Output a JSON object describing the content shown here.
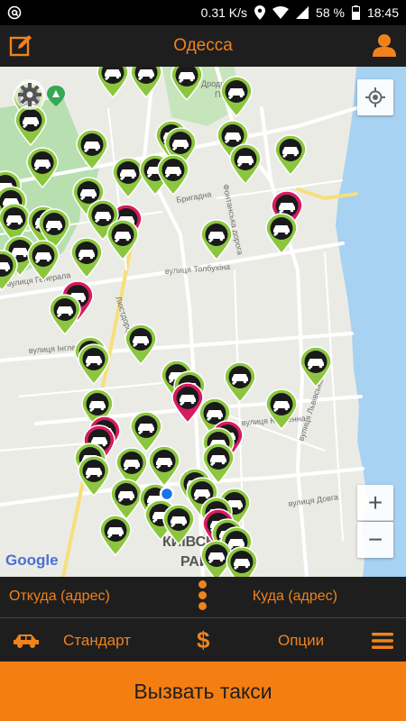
{
  "statusbar": {
    "left_icon": "at-icon",
    "network_speed": "0.31 K/s",
    "battery_percent": "58 %",
    "time": "18:45"
  },
  "header": {
    "title": "Одесса"
  },
  "map": {
    "labels": [
      "Дродромк",
      "Перем",
      "вулиця Толбухіна",
      "Бригадна",
      "Фонтанська дорога",
      "Люстдорфська",
      "вулиця Генерала",
      "вулиця Інглезі",
      "вулиця Косвенна",
      "вулиця Львівська",
      "вулиця Довга",
      "КИЇВСЬКИЙ",
      "РАЙОН",
      "Google"
    ],
    "zoom_in_label": "+",
    "zoom_out_label": "−",
    "colors": {
      "taxi_free": "#8cc63f",
      "taxi_busy": "#d81b60",
      "water": "#a7d2f1",
      "park": "#b8dfb0"
    },
    "taxi_markers": [
      [
        125,
        82,
        "g"
      ],
      [
        162,
        82,
        "g"
      ],
      [
        207,
        85,
        "g"
      ],
      [
        262,
        103,
        "g"
      ],
      [
        32,
        110,
        "g"
      ],
      [
        34,
        135,
        "g"
      ],
      [
        190,
        152,
        "g"
      ],
      [
        200,
        160,
        "g"
      ],
      [
        258,
        152,
        "g"
      ],
      [
        102,
        162,
        "g"
      ],
      [
        322,
        168,
        "g"
      ],
      [
        272,
        178,
        "g"
      ],
      [
        47,
        182,
        "g"
      ],
      [
        142,
        193,
        "g"
      ],
      [
        172,
        190,
        "g"
      ],
      [
        192,
        190,
        "g"
      ],
      [
        6,
        208,
        "g"
      ],
      [
        98,
        215,
        "g"
      ],
      [
        12,
        225,
        "g"
      ],
      [
        318,
        230,
        "p"
      ],
      [
        140,
        245,
        "p"
      ],
      [
        114,
        240,
        "g"
      ],
      [
        16,
        244,
        "g"
      ],
      [
        48,
        247,
        "g"
      ],
      [
        60,
        250,
        "g"
      ],
      [
        136,
        262,
        "g"
      ],
      [
        312,
        255,
        "g"
      ],
      [
        240,
        262,
        "g"
      ],
      [
        22,
        280,
        "g"
      ],
      [
        48,
        285,
        "g"
      ],
      [
        96,
        282,
        "g"
      ],
      [
        2,
        296,
        "g"
      ],
      [
        86,
        330,
        "p"
      ],
      [
        72,
        345,
        "g"
      ],
      [
        156,
        378,
        "g"
      ],
      [
        100,
        392,
        "g"
      ],
      [
        104,
        400,
        "g"
      ],
      [
        350,
        403,
        "g"
      ],
      [
        196,
        418,
        "g"
      ],
      [
        210,
        430,
        "g"
      ],
      [
        266,
        420,
        "g"
      ],
      [
        208,
        443,
        "p"
      ],
      [
        108,
        450,
        "g"
      ],
      [
        312,
        450,
        "g"
      ],
      [
        116,
        480,
        "p"
      ],
      [
        110,
        490,
        "p"
      ],
      [
        162,
        475,
        "g"
      ],
      [
        238,
        460,
        "g"
      ],
      [
        252,
        485,
        "p"
      ],
      [
        242,
        493,
        "g"
      ],
      [
        100,
        510,
        "g"
      ],
      [
        242,
        510,
        "g"
      ],
      [
        146,
        515,
        "g"
      ],
      [
        182,
        513,
        "g"
      ],
      [
        104,
        524,
        "g"
      ],
      [
        216,
        538,
        "g"
      ],
      [
        224,
        548,
        "g"
      ],
      [
        140,
        550,
        "g"
      ],
      [
        172,
        555,
        "g"
      ],
      [
        260,
        560,
        "g"
      ],
      [
        178,
        573,
        "g"
      ],
      [
        198,
        578,
        "g"
      ],
      [
        240,
        570,
        "g"
      ],
      [
        242,
        583,
        "p"
      ],
      [
        128,
        590,
        "g"
      ],
      [
        252,
        594,
        "g"
      ],
      [
        262,
        603,
        "g"
      ],
      [
        240,
        618,
        "g"
      ],
      [
        268,
        625,
        "g"
      ]
    ]
  },
  "address_bar": {
    "from_label": "Откуда (адрес)",
    "to_label": "Куда (адрес)"
  },
  "options_bar": {
    "tariff_label": "Стандарт",
    "currency_symbol": "$",
    "options_label": "Опции"
  },
  "call_button": {
    "label": "Вызвать такси"
  }
}
